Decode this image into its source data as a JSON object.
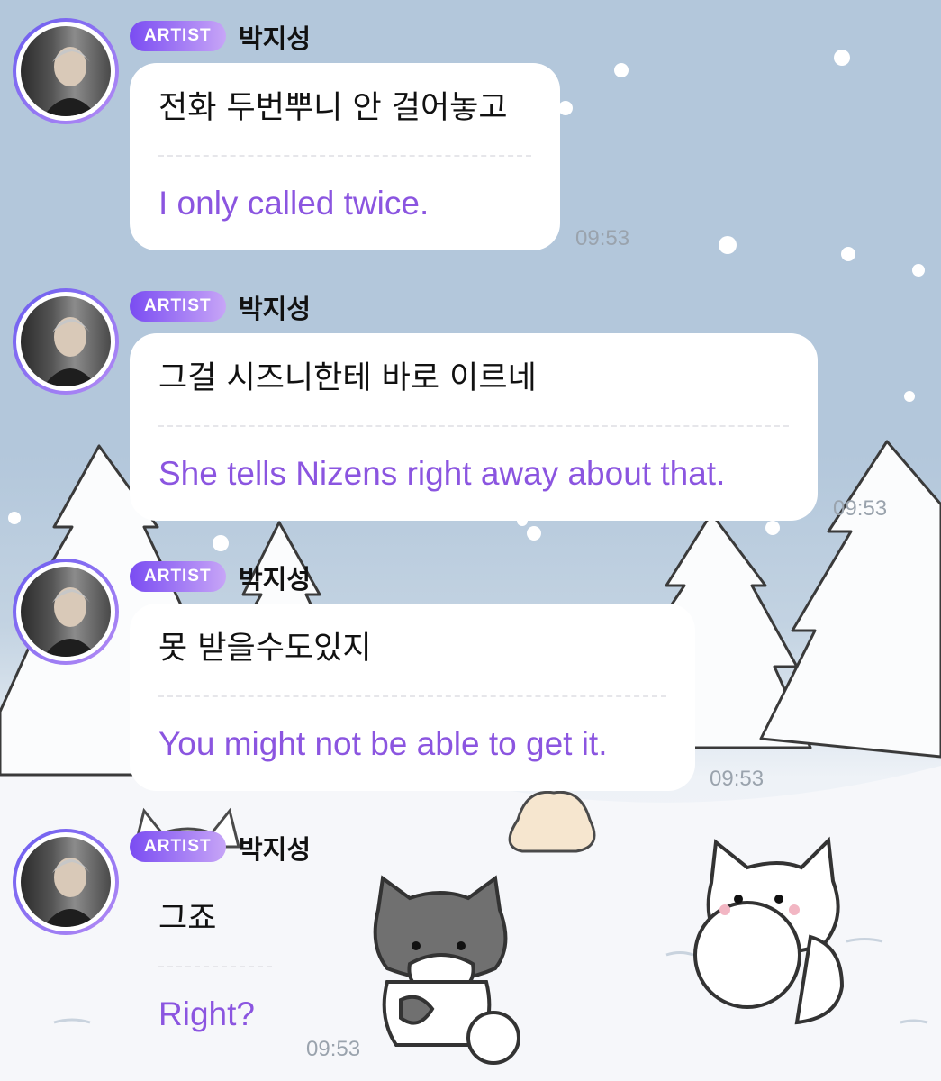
{
  "messages": [
    {
      "badge": "ARTIST",
      "sender": "박지성",
      "korean": "전화 두번뿌니 안 걸어놓고",
      "english": "I only called twice.",
      "time": "09:53"
    },
    {
      "badge": "ARTIST",
      "sender": "박지성",
      "korean": "그걸 시즈니한테 바로 이르네",
      "english": "She tells Nizens right away about that.",
      "time": "09:53"
    },
    {
      "badge": "ARTIST",
      "sender": "박지성",
      "korean": "못 받을수도있지",
      "english": "You might not be able to get it.",
      "time": "09:53"
    },
    {
      "badge": "ARTIST",
      "sender": "박지성",
      "korean": "그죠",
      "english": "Right?",
      "time": "09:53"
    }
  ],
  "colors": {
    "sky": "#b3c7db",
    "snow": "#f8f9fb",
    "badge_start": "#7a4cf2",
    "badge_end": "#c7a5f7",
    "translation_text": "#8b55e0",
    "timestamp": "#9aa3ad"
  },
  "icons": [
    "avatar-photo",
    "snowflake",
    "snowy-tree",
    "cat-sticker"
  ]
}
